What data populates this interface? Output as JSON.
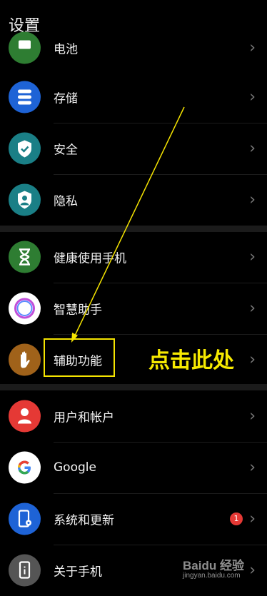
{
  "header": {
    "title": "设置"
  },
  "items": [
    {
      "label": "电池",
      "icon": "battery-icon",
      "color": "#2e7d32"
    },
    {
      "label": "存储",
      "icon": "storage-icon",
      "color": "#1e63d6"
    },
    {
      "label": "安全",
      "icon": "shield-icon",
      "color": "#1a7f86"
    },
    {
      "label": "隐私",
      "icon": "privacy-icon",
      "color": "#1a7f86"
    },
    {
      "label": "健康使用手机",
      "icon": "hourglass-icon",
      "color": "#2e7d32"
    },
    {
      "label": "智慧助手",
      "icon": "assistant-icon",
      "color": "#ffffff"
    },
    {
      "label": "辅助功能",
      "icon": "hand-icon",
      "color": "#a0621a"
    },
    {
      "label": "用户和帐户",
      "icon": "user-icon",
      "color": "#e53935"
    },
    {
      "label": "Google",
      "icon": "google-icon",
      "color": "#ffffff"
    },
    {
      "label": "系统和更新",
      "icon": "phone-settings-icon",
      "color": "#1e63d6",
      "badge": "1"
    },
    {
      "label": "关于手机",
      "icon": "about-phone-icon",
      "color": "#555555"
    }
  ],
  "annotation": {
    "callout": "点击此处",
    "color": "#f7ea00"
  },
  "watermark": {
    "brand": "Baidu 经验",
    "url": "jingyan.baidu.com"
  }
}
